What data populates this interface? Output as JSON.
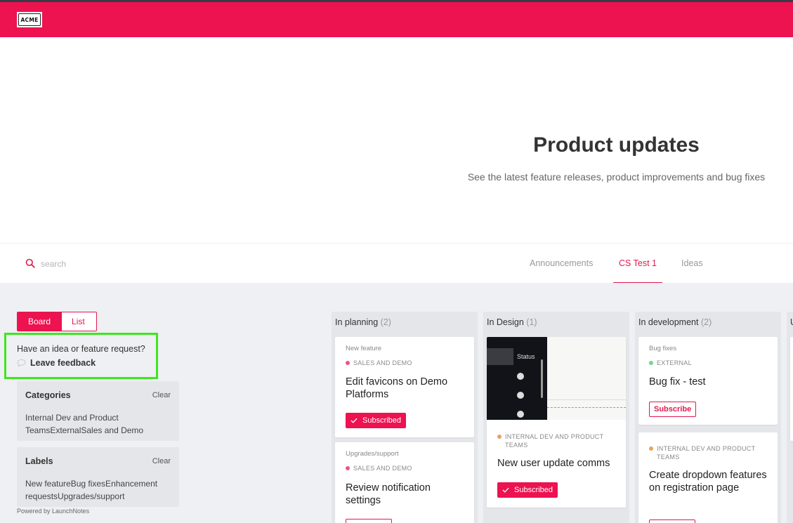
{
  "header": {
    "logo_text": "ACME",
    "brand_color": "#ed1250"
  },
  "hero": {
    "title": "Product updates",
    "subtitle": "See the latest feature releases, product improvements and bug fixes"
  },
  "search": {
    "placeholder": "search"
  },
  "nav_tabs": [
    {
      "label": "Announcements",
      "active": false
    },
    {
      "label": "CS Test 1",
      "active": true
    },
    {
      "label": "Ideas",
      "active": false
    }
  ],
  "view_toggle": {
    "board_label": "Board",
    "list_label": "List",
    "selected": "Board"
  },
  "feedback": {
    "question": "Have an idea or feature request?",
    "link_label": "Leave feedback",
    "highlight_color": "#3fe61f"
  },
  "filters": {
    "categories": {
      "title": "Categories",
      "clear_label": "Clear",
      "values": "Internal Dev and Product TeamsExternalSales and Demo"
    },
    "labels": {
      "title": "Labels",
      "clear_label": "Clear",
      "values": "New featureBug fixesEnhancement requestsUpgrades/support"
    }
  },
  "footer": {
    "powered_by": "Powered by LaunchNotes"
  },
  "columns": [
    {
      "title": "In planning",
      "count": "(2)",
      "cards": [
        {
          "category": "New feature",
          "team": "SALES AND DEMO",
          "team_color": "#e8577f",
          "title": "Edit favicons on Demo Platforms",
          "button": "Subscribed"
        },
        {
          "category": "Upgrades/support",
          "team": "SALES AND DEMO",
          "team_color": "#e8577f",
          "title": "Review notification settings"
        }
      ]
    },
    {
      "title": "In Design",
      "count": "(1)",
      "cards": [
        {
          "image_status_text": "Status",
          "team": "INTERNAL DEV AND PRODUCT TEAMS",
          "team_color": "#e8a35c",
          "title": "New user update comms",
          "button": "Subscribed"
        }
      ]
    },
    {
      "title": "In development",
      "count": "(2)",
      "cards": [
        {
          "category": "Bug fixes",
          "team": "EXTERNAL",
          "team_color": "#7bd38a",
          "title": "Bug fix - test",
          "button": "Subscribe"
        },
        {
          "team": "INTERNAL DEV AND PRODUCT TEAMS",
          "team_color": "#e8a35c",
          "title": "Create dropdown features on registration page"
        }
      ]
    },
    {
      "title": "U",
      "count": ""
    }
  ]
}
